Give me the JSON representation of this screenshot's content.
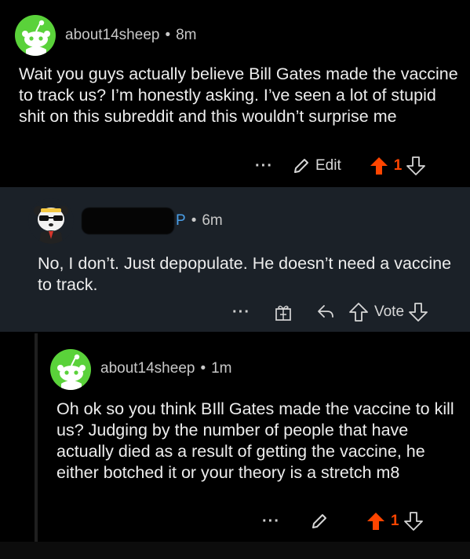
{
  "comments": [
    {
      "username": "about14sheep",
      "separator": "•",
      "time": "8m",
      "body": "Wait you guys actually believe Bill Gates made the vaccine to track us? I’m honestly asking. I’ve seen a lot of stupid shit on this subreddit and this wouldn’t surprise me",
      "actions": {
        "more": "···",
        "edit_label": "Edit",
        "score": "1"
      },
      "vote_state": "upvoted",
      "accent_color": "#ff4500"
    },
    {
      "username_visible_suffix": "P",
      "separator": "•",
      "time": "6m",
      "body": "No, I don’t. Just depopulate. He doesn’t need a vaccine to track.",
      "actions": {
        "more": "···",
        "vote_label": "Vote"
      },
      "background": "#1b2128",
      "flair_color": "#4a9fe8"
    },
    {
      "username": "about14sheep",
      "separator": "•",
      "time": "1m",
      "body": "Oh ok so you think BIll Gates made the vaccine to kill us? Judging by the number of people that have actually died as a result of getting the vaccine, he either botched it or your theory is a stretch m8",
      "actions": {
        "more": "···",
        "score": "1"
      },
      "vote_state": "upvoted"
    }
  ],
  "icons": {
    "avatar_default": "reddit-snoo-avatar",
    "avatar_panda": "panda-sunglasses-avatar",
    "edit": "pencil-icon",
    "upvote": "upvote-arrow-icon",
    "downvote": "downvote-arrow-icon",
    "award": "gift-award-icon",
    "reply": "reply-arrow-icon"
  }
}
